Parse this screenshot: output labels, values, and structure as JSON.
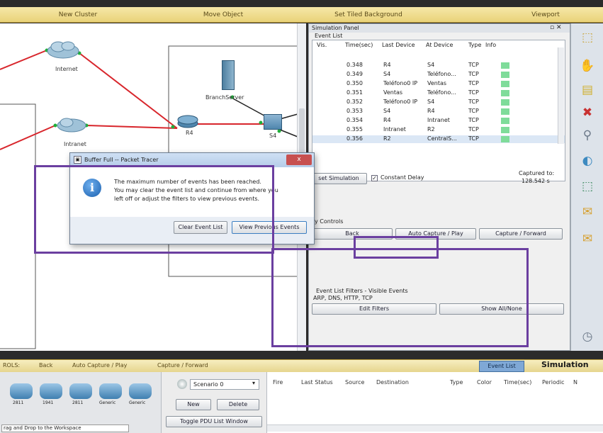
{
  "toolbar": {
    "new_cluster": "New Cluster",
    "move_object": "Move Object",
    "set_tiled_background": "Set Tiled Background",
    "viewport": "Viewport"
  },
  "workspace": {
    "devices": {
      "internet": "Internet",
      "intranet": "Intranet",
      "branch_server": "BranchServer",
      "r4": "R4",
      "s4": "S4"
    }
  },
  "sim_panel": {
    "title": "Simulation Panel",
    "event_list_label": "Event List",
    "columns": [
      "Vis.",
      "Time(sec)",
      "Last Device",
      "At Device",
      "Type",
      "Info"
    ],
    "rows": [
      {
        "time": "0.348",
        "last": "R4",
        "at": "S4",
        "type": "TCP"
      },
      {
        "time": "0.349",
        "last": "S4",
        "at": "Teléfono...",
        "type": "TCP"
      },
      {
        "time": "0.350",
        "last": "Teléfono0 IP",
        "at": "Ventas",
        "type": "TCP"
      },
      {
        "time": "0.351",
        "last": "Ventas",
        "at": "Teléfono...",
        "type": "TCP"
      },
      {
        "time": "0.352",
        "last": "Teléfono0 IP",
        "at": "S4",
        "type": "TCP"
      },
      {
        "time": "0.353",
        "last": "S4",
        "at": "R4",
        "type": "TCP"
      },
      {
        "time": "0.354",
        "last": "R4",
        "at": "Intranet",
        "type": "TCP"
      },
      {
        "time": "0.355",
        "last": "Intranet",
        "at": "R2",
        "type": "TCP"
      },
      {
        "time": "0.356",
        "last": "R2",
        "at": "CentralS...",
        "type": "TCP"
      }
    ],
    "reset_simulation": "set Simulation",
    "constant_delay": "Constant Delay",
    "captured_to_label": "Captured to:",
    "captured_to_value": "128.542 s",
    "play_controls_label": "y Controls",
    "back": "Back",
    "auto_capture": "Auto Capture / Play",
    "capture_forward": "Capture / Forward",
    "filters_label": "Event List Filters - Visible Events",
    "filters_value": "ARP, DNS, HTTP, TCP",
    "edit_filters": "Edit Filters",
    "show_all_none": "Show All/None"
  },
  "dialog": {
    "title": "Buffer Full -- Packet Tracer",
    "message_line1": "The maximum number of events has been reached.",
    "message_line2": "You may clear the event list and continue from where you",
    "message_line3": "left off or adjust the filters to view previous events.",
    "clear_button": "Clear Event List",
    "view_previous_button": "View Previous Events",
    "close": "x"
  },
  "bottom": {
    "tools_label": "ROLS:",
    "back": "Back",
    "auto_capture": "Auto Capture / Play",
    "capture_forward": "Capture / Forward",
    "event_list_tab": "Event List",
    "simulation_tab": "Simulation",
    "scenario": "Scenario 0",
    "new": "New",
    "delete": "Delete",
    "toggle_pdu": "Toggle PDU List Window",
    "pdu_columns": [
      "Fire",
      "Last Status",
      "Source",
      "Destination",
      "Type",
      "Color",
      "Time(sec)",
      "Periodic",
      "N"
    ],
    "device_labels": [
      "2811",
      "1941",
      "2811",
      "Generic",
      "Generic"
    ],
    "status_text": "rag and Drop to the Workspace"
  },
  "colors": {
    "highlight_box": "#6b3fa0",
    "link_red": "#d8262c",
    "link_green": "#1fae3a"
  }
}
